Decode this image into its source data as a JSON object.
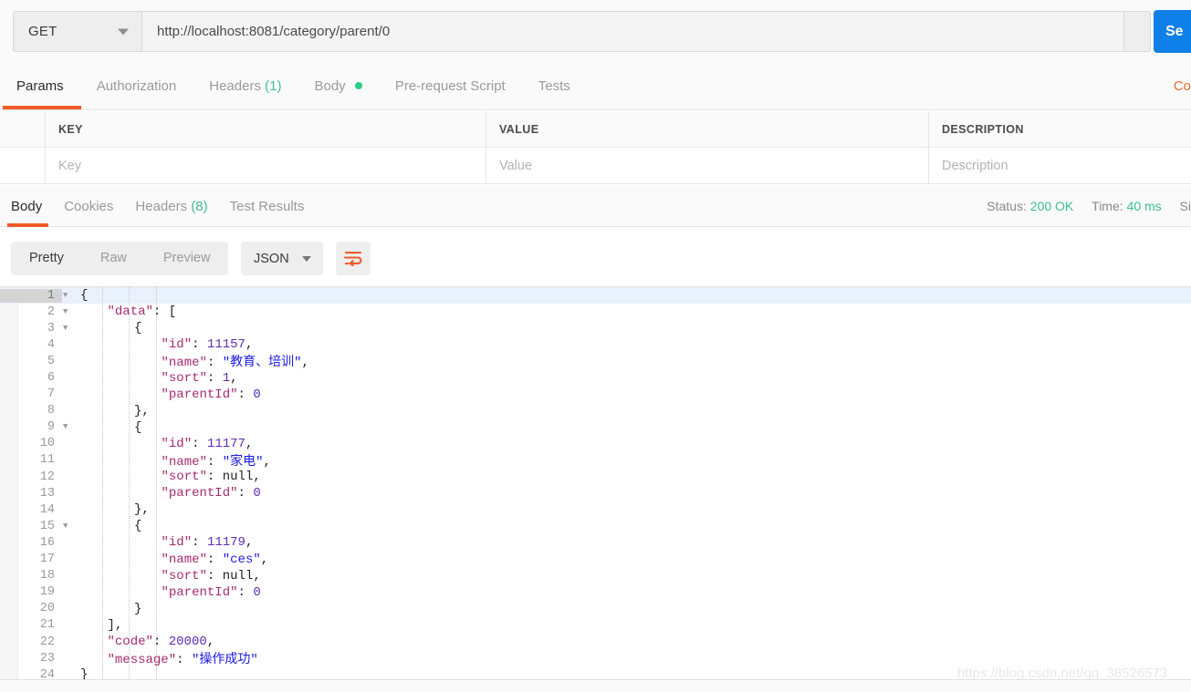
{
  "request": {
    "method": "GET",
    "url": "http://localhost:8081/category/parent/0",
    "send_label": "Se",
    "tabs": [
      {
        "label": "Params",
        "active": true
      },
      {
        "label": "Authorization",
        "active": false
      },
      {
        "label": "Headers",
        "count": "(1)",
        "active": false
      },
      {
        "label": "Body",
        "dot": true,
        "active": false
      },
      {
        "label": "Pre-request Script",
        "active": false
      },
      {
        "label": "Tests",
        "active": false
      }
    ],
    "cookies_link": "Co"
  },
  "params_table": {
    "headers": [
      "KEY",
      "VALUE",
      "DESCRIPTION"
    ],
    "placeholder_row": [
      "Key",
      "Value",
      "Description"
    ]
  },
  "response": {
    "tabs": [
      {
        "label": "Body",
        "active": true
      },
      {
        "label": "Cookies",
        "active": false
      },
      {
        "label": "Headers",
        "count": "(8)",
        "active": false
      },
      {
        "label": "Test Results",
        "active": false
      }
    ],
    "status_label": "Status:",
    "status_value": "200 OK",
    "time_label": "Time:",
    "time_value": "40 ms",
    "size_label": "Si",
    "view_modes": [
      {
        "label": "Pretty",
        "active": true
      },
      {
        "label": "Raw",
        "active": false
      },
      {
        "label": "Preview",
        "active": false
      }
    ],
    "format": "JSON",
    "wrap_icon": "word-wrap-icon"
  },
  "colors": {
    "accent_orange": "#f15a29",
    "send_blue": "#0f80e8",
    "status_green": "#3ebd93",
    "key_magenta": "#a52a6e",
    "string_blue": "#1a1ae6",
    "number_purple": "#5c2bb5"
  },
  "watermark": "https://blog.csdn.net/qq_38526573",
  "code": {
    "language": "json",
    "active_line": 1,
    "lines": [
      {
        "n": 1,
        "fold": true,
        "indent": 0,
        "tokens": [
          {
            "t": "{",
            "c": "p"
          }
        ]
      },
      {
        "n": 2,
        "fold": true,
        "indent": 1,
        "tokens": [
          {
            "t": "\"data\"",
            "c": "k"
          },
          {
            "t": ": [",
            "c": "p"
          }
        ]
      },
      {
        "n": 3,
        "fold": true,
        "indent": 2,
        "tokens": [
          {
            "t": "{",
            "c": "p"
          }
        ]
      },
      {
        "n": 4,
        "fold": false,
        "indent": 3,
        "tokens": [
          {
            "t": "\"id\"",
            "c": "k"
          },
          {
            "t": ": ",
            "c": "p"
          },
          {
            "t": "11157",
            "c": "n"
          },
          {
            "t": ",",
            "c": "p"
          }
        ]
      },
      {
        "n": 5,
        "fold": false,
        "indent": 3,
        "tokens": [
          {
            "t": "\"name\"",
            "c": "k"
          },
          {
            "t": ": ",
            "c": "p"
          },
          {
            "t": "\"教育、培训\"",
            "c": "s"
          },
          {
            "t": ",",
            "c": "p"
          }
        ]
      },
      {
        "n": 6,
        "fold": false,
        "indent": 3,
        "tokens": [
          {
            "t": "\"sort\"",
            "c": "k"
          },
          {
            "t": ": ",
            "c": "p"
          },
          {
            "t": "1",
            "c": "n"
          },
          {
            "t": ",",
            "c": "p"
          }
        ]
      },
      {
        "n": 7,
        "fold": false,
        "indent": 3,
        "tokens": [
          {
            "t": "\"parentId\"",
            "c": "k"
          },
          {
            "t": ": ",
            "c": "p"
          },
          {
            "t": "0",
            "c": "n"
          }
        ]
      },
      {
        "n": 8,
        "fold": false,
        "indent": 2,
        "tokens": [
          {
            "t": "},",
            "c": "p"
          }
        ]
      },
      {
        "n": 9,
        "fold": true,
        "indent": 2,
        "tokens": [
          {
            "t": "{",
            "c": "p"
          }
        ]
      },
      {
        "n": 10,
        "fold": false,
        "indent": 3,
        "tokens": [
          {
            "t": "\"id\"",
            "c": "k"
          },
          {
            "t": ": ",
            "c": "p"
          },
          {
            "t": "11177",
            "c": "n"
          },
          {
            "t": ",",
            "c": "p"
          }
        ]
      },
      {
        "n": 11,
        "fold": false,
        "indent": 3,
        "tokens": [
          {
            "t": "\"name\"",
            "c": "k"
          },
          {
            "t": ": ",
            "c": "p"
          },
          {
            "t": "\"家电\"",
            "c": "s"
          },
          {
            "t": ",",
            "c": "p"
          }
        ]
      },
      {
        "n": 12,
        "fold": false,
        "indent": 3,
        "tokens": [
          {
            "t": "\"sort\"",
            "c": "k"
          },
          {
            "t": ": ",
            "c": "p"
          },
          {
            "t": "null",
            "c": "p"
          },
          {
            "t": ",",
            "c": "p"
          }
        ]
      },
      {
        "n": 13,
        "fold": false,
        "indent": 3,
        "tokens": [
          {
            "t": "\"parentId\"",
            "c": "k"
          },
          {
            "t": ": ",
            "c": "p"
          },
          {
            "t": "0",
            "c": "n"
          }
        ]
      },
      {
        "n": 14,
        "fold": false,
        "indent": 2,
        "tokens": [
          {
            "t": "},",
            "c": "p"
          }
        ]
      },
      {
        "n": 15,
        "fold": true,
        "indent": 2,
        "tokens": [
          {
            "t": "{",
            "c": "p"
          }
        ]
      },
      {
        "n": 16,
        "fold": false,
        "indent": 3,
        "tokens": [
          {
            "t": "\"id\"",
            "c": "k"
          },
          {
            "t": ": ",
            "c": "p"
          },
          {
            "t": "11179",
            "c": "n"
          },
          {
            "t": ",",
            "c": "p"
          }
        ]
      },
      {
        "n": 17,
        "fold": false,
        "indent": 3,
        "tokens": [
          {
            "t": "\"name\"",
            "c": "k"
          },
          {
            "t": ": ",
            "c": "p"
          },
          {
            "t": "\"ces\"",
            "c": "s"
          },
          {
            "t": ",",
            "c": "p"
          }
        ]
      },
      {
        "n": 18,
        "fold": false,
        "indent": 3,
        "tokens": [
          {
            "t": "\"sort\"",
            "c": "k"
          },
          {
            "t": ": ",
            "c": "p"
          },
          {
            "t": "null",
            "c": "p"
          },
          {
            "t": ",",
            "c": "p"
          }
        ]
      },
      {
        "n": 19,
        "fold": false,
        "indent": 3,
        "tokens": [
          {
            "t": "\"parentId\"",
            "c": "k"
          },
          {
            "t": ": ",
            "c": "p"
          },
          {
            "t": "0",
            "c": "n"
          }
        ]
      },
      {
        "n": 20,
        "fold": false,
        "indent": 2,
        "tokens": [
          {
            "t": "}",
            "c": "p"
          }
        ]
      },
      {
        "n": 21,
        "fold": false,
        "indent": 1,
        "tokens": [
          {
            "t": "],",
            "c": "p"
          }
        ]
      },
      {
        "n": 22,
        "fold": false,
        "indent": 1,
        "tokens": [
          {
            "t": "\"code\"",
            "c": "k"
          },
          {
            "t": ": ",
            "c": "p"
          },
          {
            "t": "20000",
            "c": "n"
          },
          {
            "t": ",",
            "c": "p"
          }
        ]
      },
      {
        "n": 23,
        "fold": false,
        "indent": 1,
        "tokens": [
          {
            "t": "\"message\"",
            "c": "k"
          },
          {
            "t": ": ",
            "c": "p"
          },
          {
            "t": "\"操作成功\"",
            "c": "s"
          }
        ]
      },
      {
        "n": 24,
        "fold": false,
        "indent": 0,
        "tokens": [
          {
            "t": "}",
            "c": "p"
          }
        ]
      }
    ]
  },
  "response_json": {
    "data": [
      {
        "id": 11157,
        "name": "教育、培训",
        "sort": 1,
        "parentId": 0
      },
      {
        "id": 11177,
        "name": "家电",
        "sort": null,
        "parentId": 0
      },
      {
        "id": 11179,
        "name": "ces",
        "sort": null,
        "parentId": 0
      }
    ],
    "code": 20000,
    "message": "操作成功"
  }
}
